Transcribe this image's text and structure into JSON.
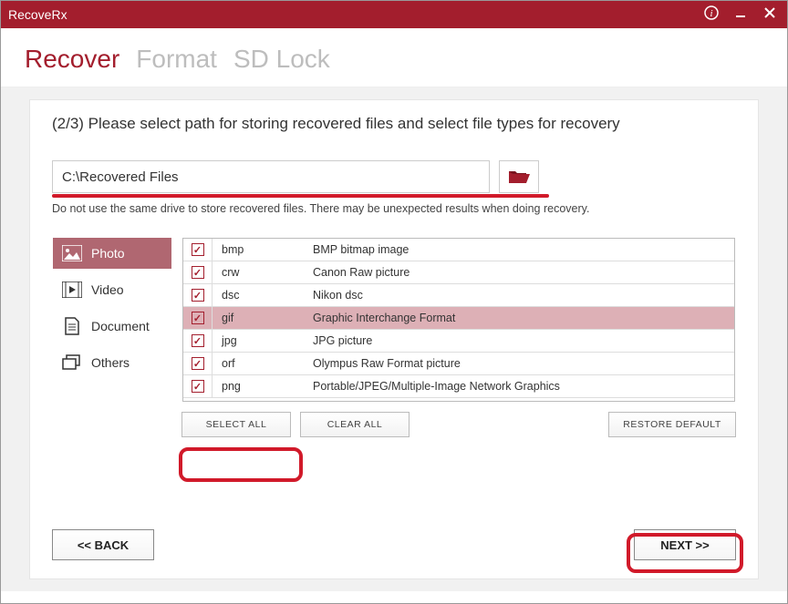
{
  "titlebar": {
    "app_name": "RecoveRx"
  },
  "tabs": {
    "recover": "Recover",
    "format": "Format",
    "sdlock": "SD Lock",
    "active": "recover"
  },
  "step": {
    "title": "(2/3) Please select path for storing recovered files and select file types for recovery"
  },
  "path": {
    "value": "C:\\Recovered Files",
    "placeholder": ""
  },
  "warning_text": "Do not use the same drive to store recovered files. There may be unexpected results when doing recovery.",
  "categories": [
    {
      "id": "photo",
      "label": "Photo",
      "active": true
    },
    {
      "id": "video",
      "label": "Video",
      "active": false
    },
    {
      "id": "document",
      "label": "Document",
      "active": false
    },
    {
      "id": "others",
      "label": "Others",
      "active": false
    }
  ],
  "filetypes": [
    {
      "ext": "bmp",
      "desc": "BMP bitmap image",
      "checked": true,
      "highlight": false
    },
    {
      "ext": "crw",
      "desc": "Canon Raw picture",
      "checked": true,
      "highlight": false
    },
    {
      "ext": "dsc",
      "desc": "Nikon dsc",
      "checked": true,
      "highlight": false
    },
    {
      "ext": "gif",
      "desc": "Graphic Interchange Format",
      "checked": true,
      "highlight": true
    },
    {
      "ext": "jpg",
      "desc": "JPG picture",
      "checked": true,
      "highlight": false
    },
    {
      "ext": "orf",
      "desc": "Olympus Raw Format picture",
      "checked": true,
      "highlight": false
    },
    {
      "ext": "png",
      "desc": "Portable/JPEG/Multiple-Image Network Graphics",
      "checked": true,
      "highlight": false
    }
  ],
  "buttons": {
    "select_all": "SELECT ALL",
    "clear_all": "CLEAR ALL",
    "restore_default": "RESTORE DEFAULT",
    "back": "<<  BACK",
    "next": "NEXT  >>"
  },
  "colors": {
    "primary": "#a31e2d",
    "annotation": "#d11a2a"
  }
}
